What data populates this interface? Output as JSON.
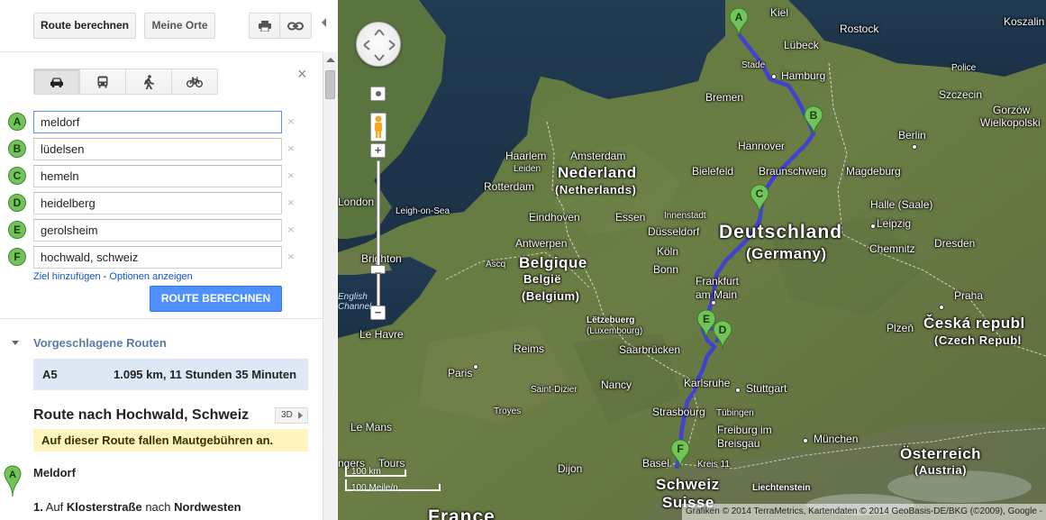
{
  "toolbar": {
    "route_button": "Route berechnen",
    "places_button": "Meine Orte",
    "print_icon": "printer-icon",
    "link_icon": "link-icon"
  },
  "travel_modes": [
    {
      "name": "car",
      "icon": "car-icon",
      "active": true
    },
    {
      "name": "transit",
      "icon": "bus-icon",
      "active": false
    },
    {
      "name": "walking",
      "icon": "walking-icon",
      "active": false
    },
    {
      "name": "bicycle",
      "icon": "bicycle-icon",
      "active": false
    }
  ],
  "close_label": "×",
  "waypoints": [
    {
      "letter": "A",
      "value": "meldorf"
    },
    {
      "letter": "B",
      "value": "lüdelsen"
    },
    {
      "letter": "C",
      "value": "hemeln"
    },
    {
      "letter": "D",
      "value": "heidelberg"
    },
    {
      "letter": "E",
      "value": "gerolsheim"
    },
    {
      "letter": "F",
      "value": "hochwald, schweiz"
    }
  ],
  "remove_label": "×",
  "links": {
    "add_destination": "Ziel hinzufügen",
    "separator": " - ",
    "show_options": "Optionen anzeigen"
  },
  "calc_button": "ROUTE BERECHNEN",
  "suggested": {
    "title": "Vorgeschlagene Routen",
    "route_name": "A5",
    "route_info": "1.095 km, 11 Stunden 35 Minuten"
  },
  "route_heading": "Route nach Hochwald, Schweiz",
  "btn_3d": "3D",
  "toll_notice": "Auf dieser Route fallen Mautgebühren an.",
  "start": {
    "letter": "A",
    "label": "Meldorf"
  },
  "step1": {
    "num": "1.",
    "pre": "Auf",
    "street": "Klosterstraße",
    "mid": "nach",
    "dir": "Nordwesten"
  },
  "map": {
    "labels": {
      "kiel": "Kiel",
      "rostock": "Rostock",
      "koszalin": "Koszalin",
      "luebeck": "Lübeck",
      "stade": "Stade",
      "hamburg": "Hamburg",
      "police": "Police",
      "szczecin": "Szczecin",
      "gorzow": "Gorzów",
      "wielkopolski": "Wielkopolski",
      "bremen": "Bremen",
      "berlin": "Berlin",
      "hannover": "Hannover",
      "haarlem": "Haarlem",
      "amsterdam": "Amsterdam",
      "leiden": "Leiden",
      "nederland": "Nederland",
      "netherlands": "(Netherlands)",
      "bielefeld": "Bielefeld",
      "braunschweig": "Braunschweig",
      "magdeburg": "Magdeburg",
      "rotterdam": "Rotterdam",
      "halle": "Halle (Saale)",
      "london": "London",
      "leigh": "Leigh-on-Sea",
      "eindhoven": "Eindhoven",
      "essen": "Essen",
      "innenstadt": "Innenstadt",
      "deutschland": "Deutschland",
      "leipzig": "Leipzig",
      "germany": "(Germany)",
      "duesseldorf": "Düsseldorf",
      "chemnitz": "Chemnitz",
      "dresden": "Dresden",
      "antwerpen": "Antwerpen",
      "koeln": "Köln",
      "brighton": "Brighton",
      "belgique": "Belgique",
      "belgie": "België",
      "belgium": "(Belgium)",
      "bonn": "Bonn",
      "ascq": "Ascq",
      "english_channel": "English Channel",
      "frankfurt": "Frankfurt",
      "am_main": "am Main",
      "praha": "Praha",
      "le_havre": "Le Havre",
      "letzebuerg": "Lëtzebuerg",
      "luxembourg": "(Luxembourg)",
      "plzen": "Plzeň",
      "cesko": "Česká republ",
      "czech": "(Czech Republ",
      "reims": "Reims",
      "saarbruecken": "Saarbrücken",
      "paris": "Paris",
      "nancy": "Nancy",
      "karlsruhe": "Karlsruhe",
      "stuttgart": "Stuttgart",
      "saint_dizier": "Saint-Dizier",
      "troyes": "Troyes",
      "strasbourg": "Strasbourg",
      "tuebingen": "Tübingen",
      "le_mans": "Le Mans",
      "freiburg": "Freiburg im",
      "breisgau": "Breisgau",
      "muenchen": "München",
      "oesterreich": "Österreich",
      "austria": "(Austria)",
      "tours": "Tours",
      "dijon": "Dijon",
      "basel": "Basel",
      "kreis": "Kreis 11",
      "liechtenstein": "Liechtenstein",
      "schweiz": "Schweiz",
      "suisse": "Suisse",
      "france": "France",
      "angers": "ngers"
    },
    "scale_km": "100 km",
    "scale_mi": "100 Meile/n",
    "copyright": "Grafiken © 2014 TerraMetrics, Kartendaten © 2014 GeoBasis-DE/BKG (©2009), Google -"
  }
}
